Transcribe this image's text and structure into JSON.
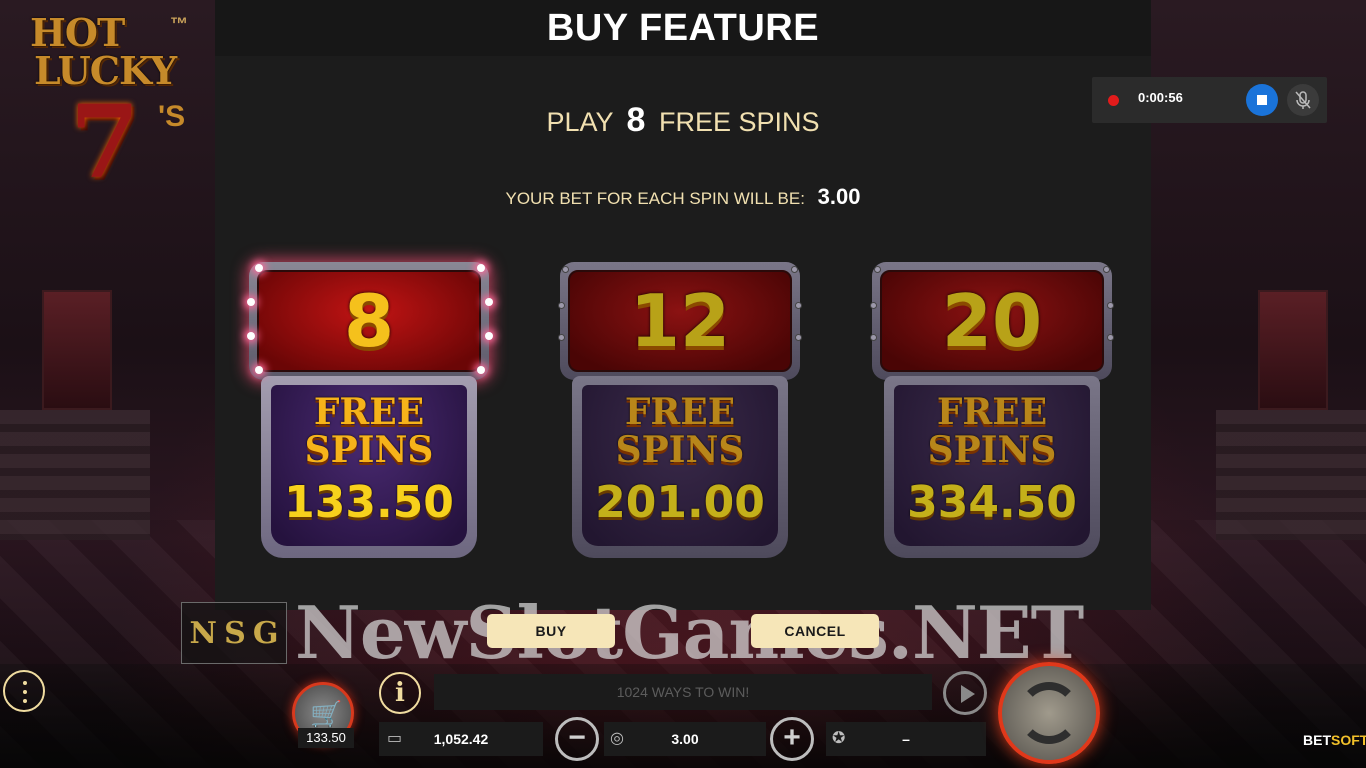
{
  "game": {
    "logo_line1": "HOT",
    "logo_line2": "LUCKY",
    "logo_seven": "7",
    "logo_s": "'S",
    "logo_tm": "™"
  },
  "dialog": {
    "title": "BUY FEATURE",
    "play_prefix": "PLAY",
    "play_count": "8",
    "play_suffix": "FREE SPINS",
    "bet_label": "YOUR BET FOR EACH SPIN WILL BE:",
    "bet_value": "3.00",
    "options": [
      {
        "count": "8",
        "line1": "FREE",
        "line2": "SPINS",
        "price": "133.50",
        "selected": true
      },
      {
        "count": "12",
        "line1": "FREE",
        "line2": "SPINS",
        "price": "201.00",
        "selected": false
      },
      {
        "count": "20",
        "line1": "FREE",
        "line2": "SPINS",
        "price": "334.50",
        "selected": false
      }
    ],
    "buy_label": "BUY",
    "cancel_label": "CANCEL"
  },
  "watermark": {
    "box_letters": [
      "N",
      "S",
      "G"
    ],
    "text": "NewSlotGames.NET"
  },
  "recorder": {
    "time": "0:00:56"
  },
  "bottom_bar": {
    "info_label": "i",
    "ways_text": "1024 WAYS TO WIN!",
    "buy_feature_price": "133.50",
    "balance": "1,052.42",
    "bet": "3.00",
    "win": "–",
    "minus_label": "−",
    "plus_label": "+",
    "brand_prefix": "BET",
    "brand_suffix": "SOFT"
  },
  "colors": {
    "accent_gold": "#f5c11c",
    "button_cream": "#f6e6b8",
    "record_red": "#e21b1b",
    "stop_blue": "#1a73d9",
    "spin_ring": "#e0381a"
  }
}
